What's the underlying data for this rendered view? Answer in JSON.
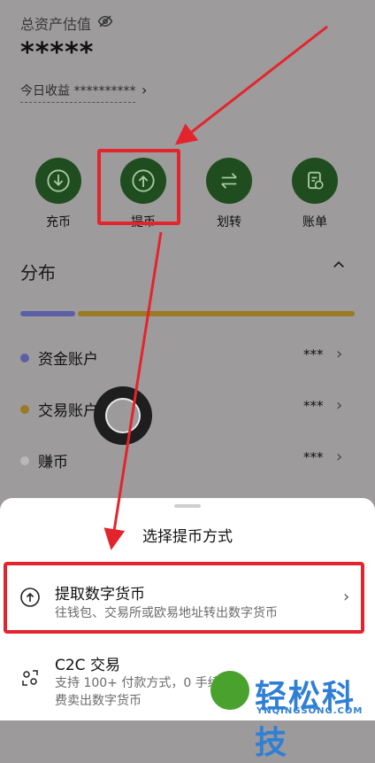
{
  "header": {
    "total_label": "总资产估值",
    "total_value": "*****",
    "today_label": "今日收益",
    "today_value": "**********"
  },
  "actions": [
    {
      "label": "充币",
      "icon": "download-circle-icon"
    },
    {
      "label": "提币",
      "icon": "upload-circle-icon"
    },
    {
      "label": "划转",
      "icon": "transfer-arrows-icon"
    },
    {
      "label": "账单",
      "icon": "bill-icon"
    }
  ],
  "distribution": {
    "title": "分布",
    "accounts": [
      {
        "name": "资金账户",
        "value": "***",
        "color": "#5b5fa6"
      },
      {
        "name": "交易账户",
        "value": "***",
        "color": "#9a7a22"
      },
      {
        "name": "赚币",
        "value": "***",
        "color": "#b9b9b9"
      }
    ]
  },
  "sheet": {
    "title": "选择提币方式",
    "options": [
      {
        "title": "提取数字货币",
        "desc": "往钱包、交易所或欧易地址转出数字货币",
        "icon": "upload-circle-icon"
      },
      {
        "title": "C2C 交易",
        "desc": "支持 100+ 付款方式，0 手续费卖出数字货币",
        "icon": "people-swap-icon"
      }
    ]
  },
  "watermark": {
    "text": "轻松科技",
    "sub": "YNQINGSONG.COM"
  },
  "colors": {
    "action_bg": "#1f4d1f",
    "highlight_red": "#e4242c"
  }
}
